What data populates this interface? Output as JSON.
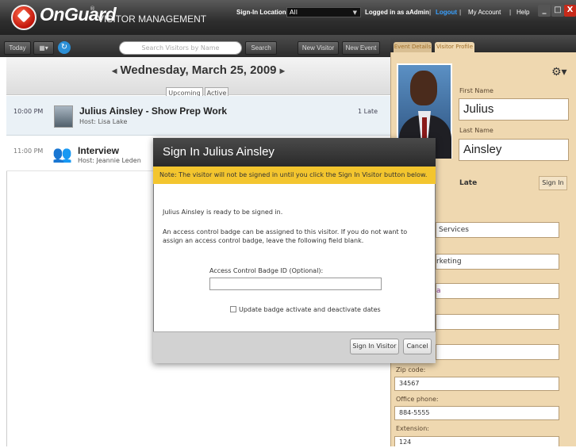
{
  "header": {
    "brand": "OnGuard",
    "trademark": "®",
    "subtitle": "VISITOR MANAGEMENT",
    "sign_in_location_label": "Sign-In Location",
    "sign_in_location_value": "All",
    "logged_in_text": "Logged in as aAdmin",
    "logout": "Logout",
    "my_account": "My Account",
    "help": "Help",
    "minimize": "_",
    "maximize": "□",
    "close": "X"
  },
  "toolbar": {
    "today": "Today",
    "search_placeholder": "Search Visitors by Name",
    "search_button": "Search",
    "new_visitor": "New Visitor",
    "new_event": "New Event"
  },
  "date_nav": {
    "date": "Wednesday, March 25, 2009",
    "prev": "◂",
    "next": "▸",
    "tabs": [
      "Upcoming",
      "Active"
    ]
  },
  "events": [
    {
      "time": "10:00 PM",
      "title": "Julius Ainsley - Show Prep Work",
      "host": "Host: Lisa Lake",
      "status": "1 Late"
    },
    {
      "time": "11:00 PM",
      "title": "Interview",
      "host": "Host: Jeannie Leden",
      "status": ""
    }
  ],
  "right_panel": {
    "tabs": [
      "Event Details",
      "Visitor Profile"
    ],
    "first_name_label": "First Name",
    "first_name": "Julius",
    "last_name_label": "Last Name",
    "last_name": "Ainsley",
    "status": "Late",
    "sign_in_link": "Sign In",
    "partial_values": [
      "Services",
      "rketing",
      "a"
    ],
    "zip_label": "Zip code:",
    "zip": "34567",
    "office_phone_label": "Office phone:",
    "office_phone": "884-5555",
    "extension_label": "Extension:",
    "extension": "124"
  },
  "modal": {
    "title": "Sign In Julius Ainsley",
    "note": "Note: The visitor will not be signed in until you click the Sign In Visitor button below.",
    "ready_text": "Julius Ainsley is ready to be signed in.",
    "info_text": "An access control badge can be assigned to this visitor. If you do not want to assign an access control badge, leave the following field blank.",
    "badge_label": "Access Control Badge ID (Optional):",
    "badge_value": "",
    "checkbox_label": "Update badge activate and deactivate dates",
    "sign_in_button": "Sign In Visitor",
    "cancel_button": "Cancel"
  }
}
